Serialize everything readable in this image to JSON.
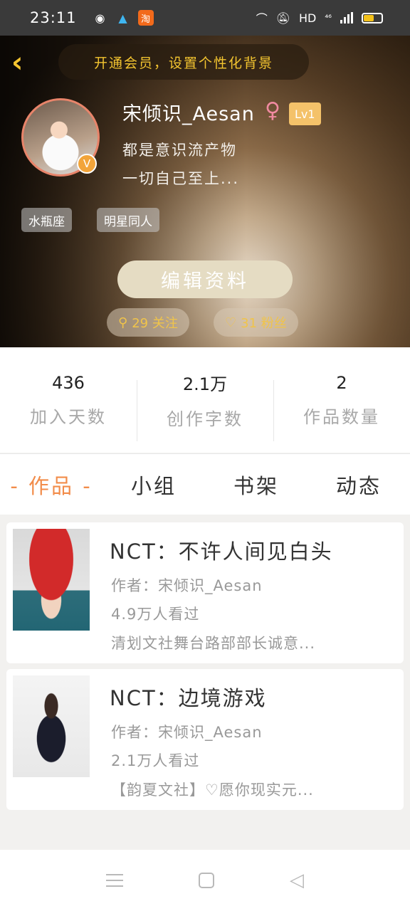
{
  "status_bar": {
    "time": "23:11",
    "hd": "HD",
    "network": "⁴⁶",
    "apps": [
      "globe-icon",
      "qq-icon",
      "taobao-icon"
    ],
    "taobao_char": "淘"
  },
  "header": {
    "vip_banner": "开通会员，设置个性化背景",
    "username": "宋倾识_Aesan",
    "gender_symbol": "♀",
    "level": "Lv1",
    "bio_line1": "都是意识流产物",
    "bio_line2": "一切自己至上...",
    "tags": [
      "水瓶座",
      "明星同人"
    ],
    "edit_button": "编辑资料",
    "follow_count": "29 关注",
    "fans_count": "31 粉丝"
  },
  "stats": [
    {
      "value": "436",
      "label": "加入天数"
    },
    {
      "value": "2.1万",
      "label": "创作字数"
    },
    {
      "value": "2",
      "label": "作品数量"
    }
  ],
  "tabs": [
    "- 作品 -",
    "小组",
    "书架",
    "动态"
  ],
  "works": [
    {
      "title": "NCT：不许人间见白头",
      "author": "作者：宋倾识_Aesan",
      "views": "4.9万人看过",
      "desc": "清划文社舞台路部部长诚意..."
    },
    {
      "title": "NCT：边境游戏",
      "author": "作者：宋倾识_Aesan",
      "views": "2.1万人看过",
      "desc": "【韵夏文社】♡愿你现实元..."
    }
  ],
  "colors": {
    "accent": "#f28c4a",
    "gold": "#f4c530"
  }
}
